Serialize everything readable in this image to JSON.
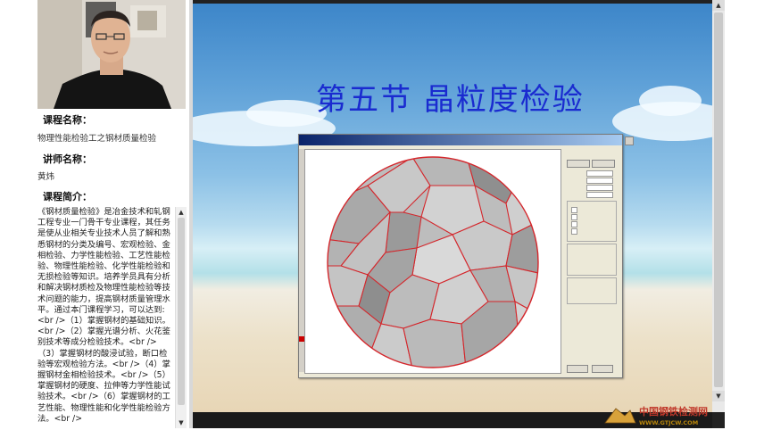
{
  "sidebar": {
    "course_name_label": "课程名称：",
    "course_name": "物理性能检验工之钢材质量检验",
    "instructor_label": "讲师名称：",
    "instructor": "黄炜",
    "intro_label": "课程简介：",
    "intro_text": "《钢材质量检验》是冶金技术和轧钢工程专业一门骨干专业课程，其任务是使从业相关专业技术人员了解和熟悉钢材的分类及编号、宏观检验、金相检验、力学性能检验、工艺性能检验、物理性能检验、化学性能检验和无损检验等知识。培养学员具有分析和解决钢材质检及物理性能检验等技术问题的能力，提高钢材质量管理水平。通过本门课程学习，可以达到: <br />（1）掌握钢材的基础知识。<br />（2）掌握光谱分析、火花鉴别技术等成分检验技术。<br />（3）掌握钢材的酸浸试验，断口检验等宏观检验方法。<br />（4）掌握钢材金相检验技术。<br />（5）掌握钢材的硬度、拉伸等力学性能试验技术。<br />（6）掌握钢材的工艺性能、物理性能和化学性能检验方法。<br />"
  },
  "slide": {
    "title": "第五节  晶粒度检验"
  },
  "watermark": {
    "text": "中国钢铁检测网",
    "url": "WWW.GTJCW.COM"
  }
}
